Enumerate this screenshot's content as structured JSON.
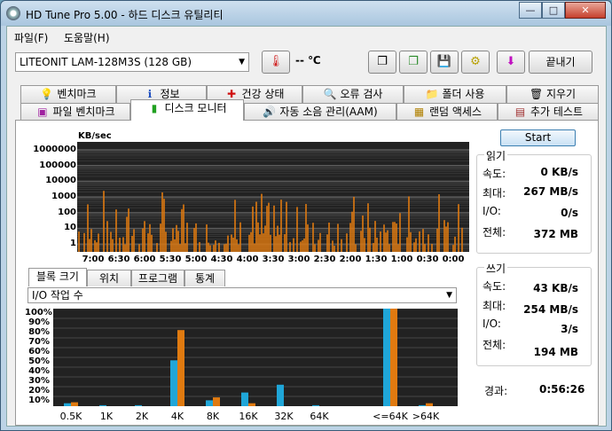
{
  "window": {
    "title": "HD Tune Pro 5.00 - 하드 디스크 유틸리티"
  },
  "menu": [
    "파일(F)",
    "도움말(H)"
  ],
  "toolbar": {
    "drive": "LITEONIT LAM-128M3S (128 GB)",
    "temperature": "-- ℃",
    "exit_label": "끝내기",
    "icons": [
      "thermometer-icon",
      "copy-info-icon",
      "copy-screen-icon",
      "save-icon",
      "options-icon",
      "download-icon"
    ]
  },
  "tabs_row1": [
    "벤치마크",
    "정보",
    "건강 상태",
    "오류 검사",
    "폴더 사용",
    "지우기"
  ],
  "tabs_row2": [
    "파일 벤치마크",
    "디스크 모니터",
    "자동 소음 관리(AAM)",
    "랜덤 액세스",
    "추가 테스트"
  ],
  "active_tab": "디스크 모니터",
  "monitor": {
    "unit_label": "KB/sec",
    "start_label": "Start",
    "y_ticks": [
      "1000000",
      "100000",
      "10000",
      "1000",
      "100",
      "10",
      "1"
    ],
    "x_ticks": [
      "7:00",
      "6:30",
      "6:00",
      "5:30",
      "5:00",
      "4:30",
      "4:00",
      "3:30",
      "3:00",
      "2:30",
      "2:00",
      "1:30",
      "1:00",
      "0:30",
      "0:00"
    ]
  },
  "read": {
    "title": "읽기",
    "speed_label": "속도:",
    "speed": "0 KB/s",
    "max_label": "최대:",
    "max": "267 MB/s",
    "io_label": "I/O:",
    "io": "0/s",
    "total_label": "전체:",
    "total": "372 MB"
  },
  "write": {
    "title": "쓰기",
    "speed_label": "속도:",
    "speed": "43 KB/s",
    "max_label": "최대:",
    "max": "254 MB/s",
    "io_label": "I/O:",
    "io": "3/s",
    "total_label": "전체:",
    "total": "194 MB"
  },
  "elapsed": {
    "label": "경과:",
    "value": "0:56:26"
  },
  "subtabs": [
    "블록 크기",
    "위치",
    "프로그램",
    "통계"
  ],
  "io_select": "I/O 작업 수",
  "colors": {
    "read": "#1fa6d8",
    "write": "#e07a10",
    "plot_bg": "#222222"
  },
  "chart_data": {
    "type": "bar",
    "categories": [
      "0.5K",
      "1K",
      "2K",
      "4K",
      "8K",
      "16K",
      "32K",
      "64K",
      "<=64K",
      ">64K"
    ],
    "series": [
      {
        "values": [
          3,
          1,
          1,
          47,
          6,
          14,
          22,
          1,
          100,
          1
        ]
      },
      {
        "values": [
          4,
          0,
          0,
          78,
          9,
          3,
          0,
          0,
          100,
          3
        ]
      }
    ],
    "y_ticks": [
      "100%",
      "90%",
      "80%",
      "70%",
      "60%",
      "50%",
      "40%",
      "30%",
      "20%",
      "10%"
    ],
    "ylim": [
      0,
      100
    ]
  }
}
